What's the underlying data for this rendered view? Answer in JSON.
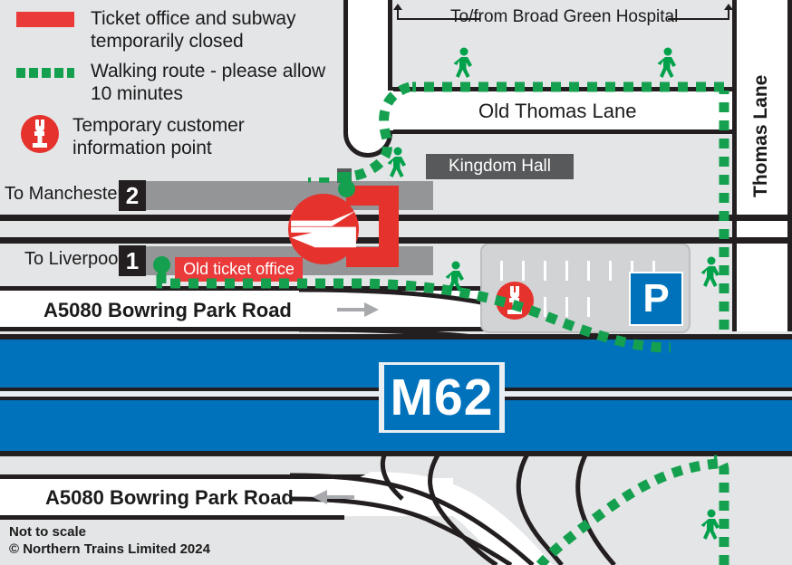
{
  "legend": {
    "items": [
      {
        "icon": "red-bar-swatch",
        "label": "Ticket office and subway temporarily closed"
      },
      {
        "icon": "green-dashed-swatch",
        "label": "Walking route - please allow 10 minutes"
      },
      {
        "icon": "information-point-icon",
        "label": "Temporary customer information point"
      }
    ]
  },
  "map": {
    "roads": {
      "hospital_route": "To/from Broad Green Hospital",
      "old_thomas_lane": "Old Thomas Lane",
      "thomas_lane": "Thomas Lane",
      "a5080_top": "A5080  Bowring Park Road",
      "a5080_bottom": "A5080  Bowring Park Road",
      "motorway": "M62"
    },
    "station": {
      "platform2_label": "To Manchester",
      "platform2_number": "2",
      "platform1_label": "To Liverpool",
      "platform1_number": "1",
      "old_ticket_office": "Old ticket office",
      "rail_logo": "national-rail-logo"
    },
    "buildings": {
      "kingdom_hall": "Kingdom Hall"
    },
    "carpark": {
      "sign": "P"
    }
  },
  "footer": {
    "scale_note": "Not to scale",
    "copyright": "© Northern Trains Limited 2024"
  },
  "colors": {
    "red": "#e5322d",
    "green": "#14a04e",
    "blue": "#0072bc",
    "grey": "#939597",
    "background": "#e4e5e7"
  }
}
